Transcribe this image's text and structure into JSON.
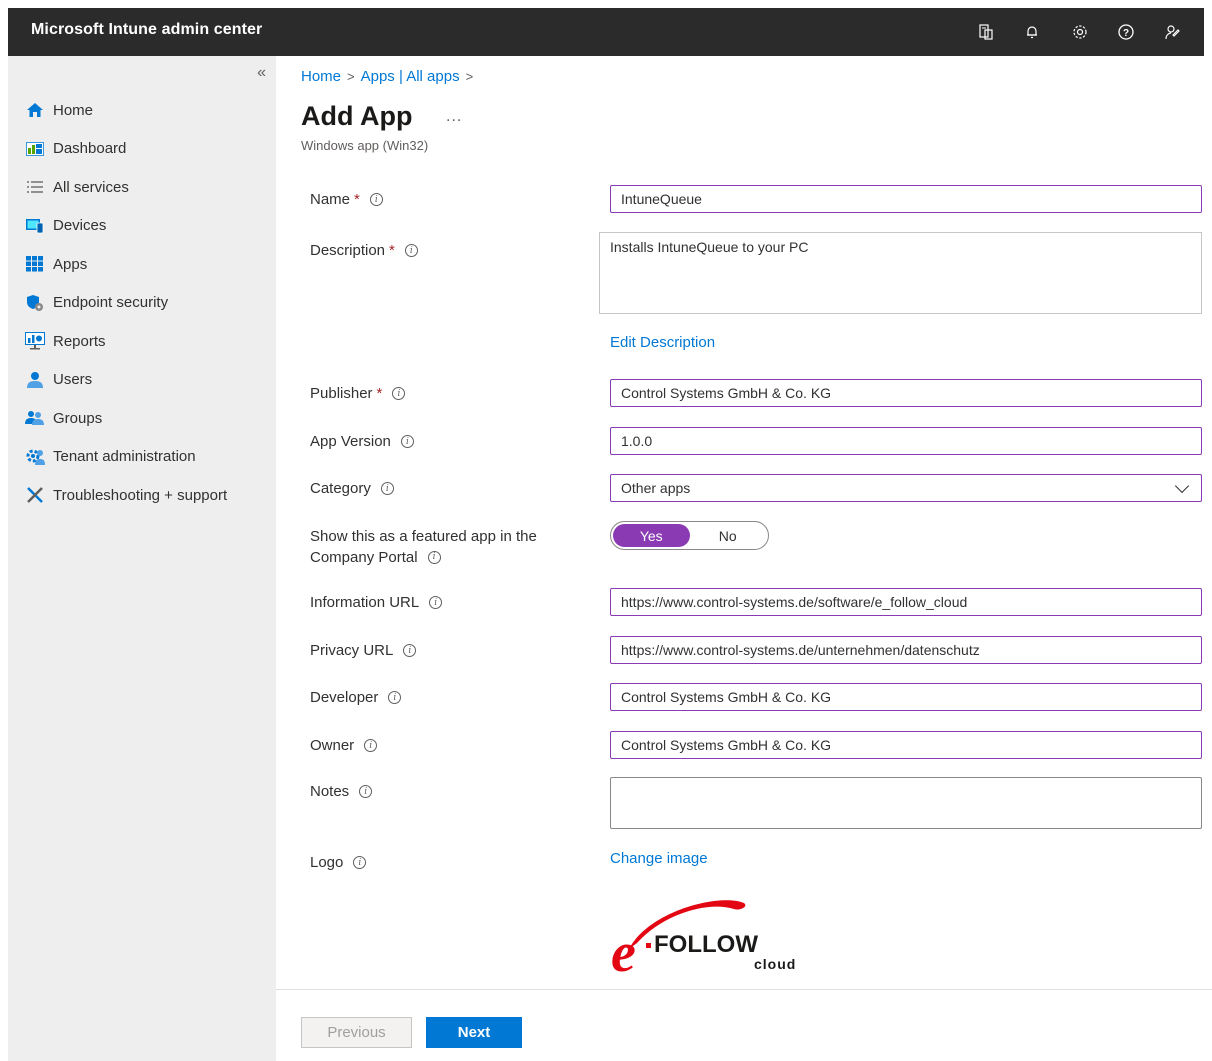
{
  "header": {
    "title": "Microsoft Intune admin center",
    "icons": [
      "portal-settings-icon",
      "bell-icon",
      "gear-icon",
      "help-icon",
      "feedback-icon"
    ]
  },
  "sidebar": {
    "collapse_glyph": "«",
    "items": [
      {
        "label": "Home",
        "icon": "home-icon"
      },
      {
        "label": "Dashboard",
        "icon": "dashboard-icon"
      },
      {
        "label": "All services",
        "icon": "list-icon"
      },
      {
        "label": "Devices",
        "icon": "devices-icon"
      },
      {
        "label": "Apps",
        "icon": "apps-icon"
      },
      {
        "label": "Endpoint security",
        "icon": "shield-icon"
      },
      {
        "label": "Reports",
        "icon": "reports-icon"
      },
      {
        "label": "Users",
        "icon": "user-icon"
      },
      {
        "label": "Groups",
        "icon": "groups-icon"
      },
      {
        "label": "Tenant administration",
        "icon": "tenant-icon"
      },
      {
        "label": "Troubleshooting + support",
        "icon": "tools-icon"
      }
    ]
  },
  "breadcrumb": {
    "home": "Home",
    "apps": "Apps | All apps",
    "sep": ">"
  },
  "page": {
    "title": "Add App",
    "more": "...",
    "subtitle": "Windows app (Win32)"
  },
  "form": {
    "name_label": "Name",
    "name_value": "IntuneQueue",
    "description_label": "Description",
    "description_value": "Installs IntuneQueue to your PC",
    "edit_description": "Edit Description",
    "publisher_label": "Publisher",
    "publisher_value": "Control Systems GmbH & Co. KG",
    "version_label": "App Version",
    "version_value": "1.0.0",
    "category_label": "Category",
    "category_value": "Other apps",
    "featured_label_1": "Show this as a featured app in the",
    "featured_label_2": "Company Portal",
    "featured_yes": "Yes",
    "featured_no": "No",
    "info_url_label": "Information URL",
    "info_url_value": "https://www.control-systems.de/software/e_follow_cloud",
    "privacy_url_label": "Privacy URL",
    "privacy_url_value": "https://www.control-systems.de/unternehmen/datenschutz",
    "developer_label": "Developer",
    "developer_value": "Control Systems GmbH & Co. KG",
    "owner_label": "Owner",
    "owner_value": "Control Systems GmbH & Co. KG",
    "notes_label": "Notes",
    "notes_value": "",
    "logo_label": "Logo",
    "change_image": "Change image",
    "required_mark": "*",
    "info_glyph": "i"
  },
  "logo_image": {
    "text_main": "FOLLOW",
    "text_sub": "cloud",
    "brand_color": "#e30613"
  },
  "footer": {
    "previous": "Previous",
    "next": "Next"
  },
  "colors": {
    "topbar": "#2b2b2b",
    "sidebar": "#eeeeee",
    "accent": "#0078d4",
    "focus_border": "#8a3bb3"
  }
}
